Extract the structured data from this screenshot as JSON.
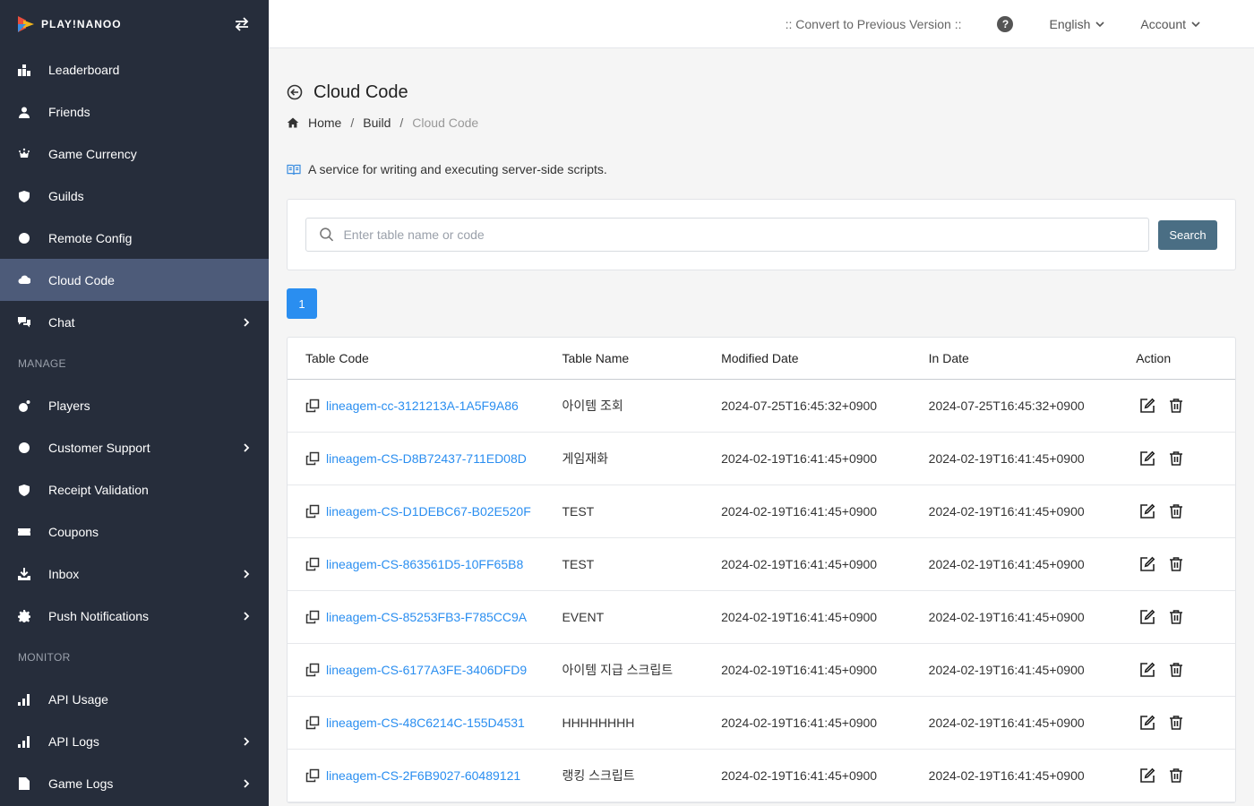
{
  "app": {
    "logo_text": "PLAY!NANOO"
  },
  "sidebar": {
    "items": [
      {
        "label": "Leaderboard",
        "icon": "leaderboard-icon",
        "active": false,
        "chevron": false
      },
      {
        "label": "Friends",
        "icon": "friends-icon",
        "active": false,
        "chevron": false
      },
      {
        "label": "Game Currency",
        "icon": "currency-icon",
        "active": false,
        "chevron": false
      },
      {
        "label": "Guilds",
        "icon": "guilds-icon",
        "active": false,
        "chevron": false
      },
      {
        "label": "Remote Config",
        "icon": "remote-config-icon",
        "active": false,
        "chevron": false
      },
      {
        "label": "Cloud Code",
        "icon": "cloud-icon",
        "active": true,
        "chevron": false
      },
      {
        "label": "Chat",
        "icon": "chat-icon",
        "active": false,
        "chevron": true
      }
    ],
    "manage_label": "MANAGE",
    "manage_items": [
      {
        "label": "Players",
        "icon": "players-icon",
        "chevron": false
      },
      {
        "label": "Customer Support",
        "icon": "support-icon",
        "chevron": true
      },
      {
        "label": "Receipt Validation",
        "icon": "shield-check-icon",
        "chevron": false
      },
      {
        "label": "Coupons",
        "icon": "coupon-icon",
        "chevron": false
      },
      {
        "label": "Inbox",
        "icon": "inbox-icon",
        "chevron": true
      },
      {
        "label": "Push Notifications",
        "icon": "gear-icon",
        "chevron": true
      }
    ],
    "monitor_label": "MONITOR",
    "monitor_items": [
      {
        "label": "API Usage",
        "icon": "bar-chart-icon",
        "chevron": false
      },
      {
        "label": "API Logs",
        "icon": "bar-chart-icon",
        "chevron": true
      },
      {
        "label": "Game Logs",
        "icon": "document-icon",
        "chevron": true
      }
    ]
  },
  "topbar": {
    "convert_link": ":: Convert to Previous Version ::",
    "help": "?",
    "language": "English",
    "account": "Account"
  },
  "page": {
    "title": "Cloud Code",
    "breadcrumb": {
      "home": "Home",
      "build": "Build",
      "current": "Cloud Code",
      "sep": "/"
    },
    "description": "A service for writing and executing server-side scripts."
  },
  "search": {
    "placeholder": "Enter table name or code",
    "button": "Search"
  },
  "pager": {
    "current": "1"
  },
  "table": {
    "headers": {
      "code": "Table Code",
      "name": "Table Name",
      "modified": "Modified Date",
      "indate": "In Date",
      "action": "Action"
    },
    "rows": [
      {
        "code": "lineagem-cc-3121213A-1A5F9A86",
        "name": "아이템 조회",
        "modified": "2024-07-25T16:45:32+0900",
        "indate": "2024-07-25T16:45:32+0900"
      },
      {
        "code": "lineagem-CS-D8B72437-711ED08D",
        "name": "게임재화",
        "modified": "2024-02-19T16:41:45+0900",
        "indate": "2024-02-19T16:41:45+0900"
      },
      {
        "code": "lineagem-CS-D1DEBC67-B02E520F",
        "name": "TEST",
        "modified": "2024-02-19T16:41:45+0900",
        "indate": "2024-02-19T16:41:45+0900"
      },
      {
        "code": "lineagem-CS-863561D5-10FF65B8",
        "name": "TEST",
        "modified": "2024-02-19T16:41:45+0900",
        "indate": "2024-02-19T16:41:45+0900"
      },
      {
        "code": "lineagem-CS-85253FB3-F785CC9A",
        "name": "EVENT",
        "modified": "2024-02-19T16:41:45+0900",
        "indate": "2024-02-19T16:41:45+0900"
      },
      {
        "code": "lineagem-CS-6177A3FE-3406DFD9",
        "name": "아이템 지급 스크립트",
        "modified": "2024-02-19T16:41:45+0900",
        "indate": "2024-02-19T16:41:45+0900"
      },
      {
        "code": "lineagem-CS-48C6214C-155D4531",
        "name": "HHHHHHHH",
        "modified": "2024-02-19T16:41:45+0900",
        "indate": "2024-02-19T16:41:45+0900"
      },
      {
        "code": "lineagem-CS-2F6B9027-60489121",
        "name": "랭킹 스크립트",
        "modified": "2024-02-19T16:41:45+0900",
        "indate": "2024-02-19T16:41:45+0900"
      }
    ]
  }
}
